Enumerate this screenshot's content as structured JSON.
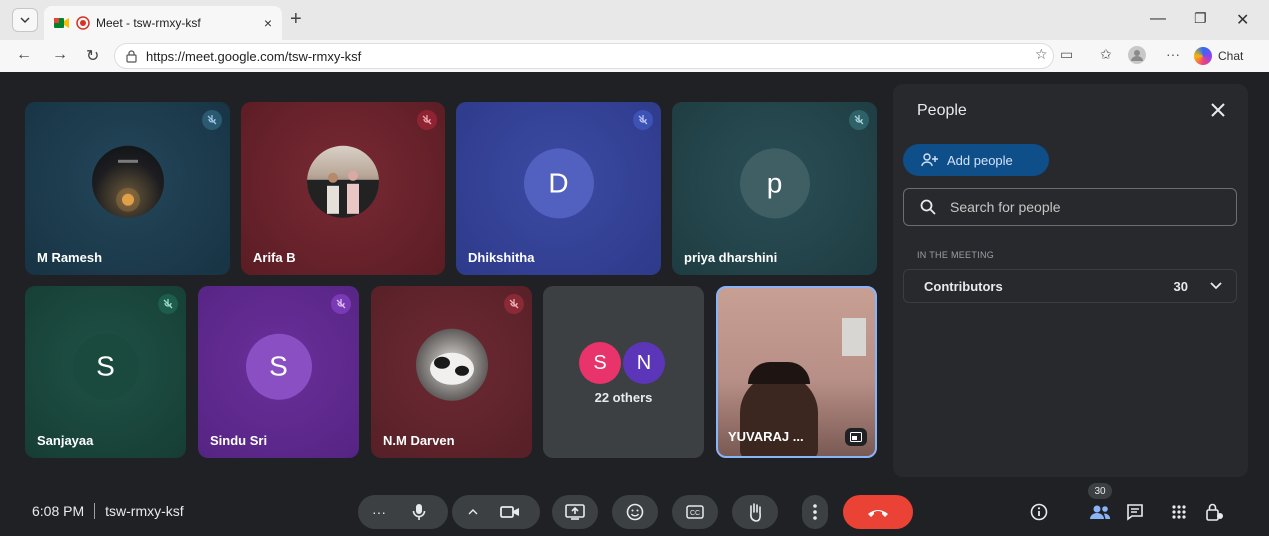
{
  "browser": {
    "tab_title": "Meet - tsw-rmxy-ksf",
    "tab_close": "×",
    "new_tab": "+",
    "url": "https://meet.google.com/tsw-rmxy-ksf",
    "chat_label": "Chat",
    "more_label": "···"
  },
  "tiles": [
    {
      "name": "M Ramesh"
    },
    {
      "name": "Arifa B"
    },
    {
      "name": "Dhikshitha",
      "initial": "D"
    },
    {
      "name": "priya dharshini",
      "initial": "p"
    },
    {
      "name": "Sanjayaa",
      "initial": "S"
    },
    {
      "name": "Sindu Sri",
      "initial": "S"
    },
    {
      "name": "N.M Darven"
    },
    {
      "others_label": "22 others",
      "initials": [
        "S",
        "N"
      ]
    },
    {
      "name": "YUVARAJ ..."
    }
  ],
  "people_panel": {
    "title": "People",
    "add_people": "Add people",
    "search_placeholder": "Search for people",
    "section_label": "IN THE MEETING",
    "group_label": "Contributors",
    "group_count": "30"
  },
  "controls": {
    "time": "6:08 PM",
    "meeting_code": "tsw-rmxy-ksf",
    "more_dots": "···",
    "participants_badge": "30"
  },
  "colors": {
    "hangup": "#ea4335",
    "accent": "#8ab4f8"
  }
}
